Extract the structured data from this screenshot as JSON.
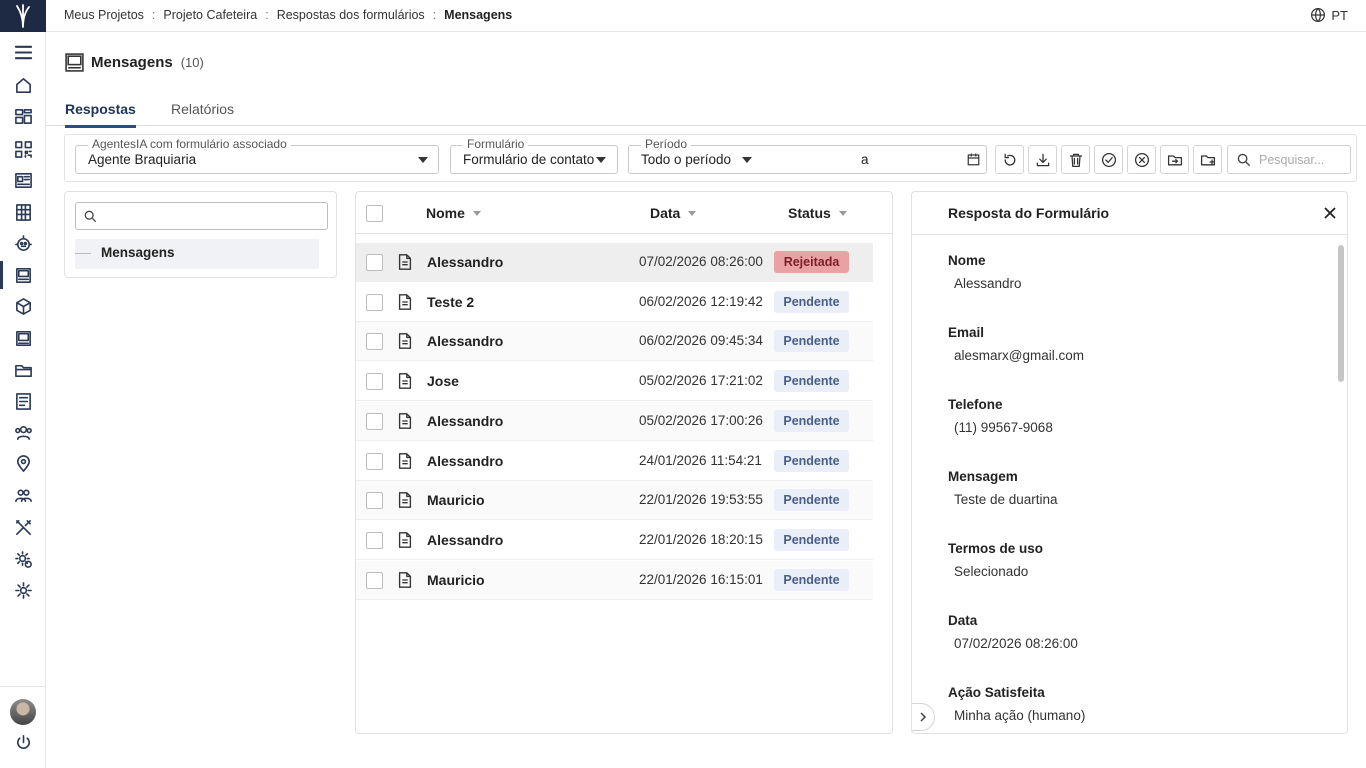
{
  "breadcrumb": {
    "items": [
      "Meus Projetos",
      "Projeto Cafeteira",
      "Respostas dos formulários"
    ],
    "separator": ":",
    "current": "Mensagens"
  },
  "language": {
    "label": "PT",
    "icon": "globe-icon"
  },
  "sidebar": {
    "items": [
      {
        "name": "menu",
        "icon": "menu-icon"
      },
      {
        "name": "home",
        "icon": "home-icon"
      },
      {
        "name": "dashboard",
        "icon": "dashboard-icon"
      },
      {
        "name": "qr-code",
        "icon": "qr-code-icon"
      },
      {
        "name": "content",
        "icon": "content-icon"
      },
      {
        "name": "grid",
        "icon": "grid-icon"
      },
      {
        "name": "agents",
        "icon": "robot-icon"
      },
      {
        "name": "forms",
        "icon": "forms-icon",
        "active": true
      },
      {
        "name": "packages",
        "icon": "cube-icon"
      },
      {
        "name": "screens",
        "icon": "monitor-icon"
      },
      {
        "name": "files",
        "icon": "folder-icon"
      },
      {
        "name": "reports",
        "icon": "report-icon"
      },
      {
        "name": "users",
        "icon": "users-icon"
      },
      {
        "name": "locations",
        "icon": "location-icon"
      },
      {
        "name": "teams",
        "icon": "team-icon"
      },
      {
        "name": "tools",
        "icon": "tools-icon"
      },
      {
        "name": "settings-admin",
        "icon": "settings-admin-icon"
      },
      {
        "name": "settings",
        "icon": "gear-icon"
      }
    ]
  },
  "page": {
    "title": "Mensagens",
    "count": "(10)"
  },
  "tabs": [
    {
      "label": "Respostas",
      "active": true
    },
    {
      "label": "Relatórios",
      "active": false
    }
  ],
  "filters": {
    "agent": {
      "legend": "AgentesIA com formulário associado",
      "value": "Agente Braquiaria"
    },
    "form": {
      "legend": "Formulário",
      "value": "Formulário de contato"
    },
    "period": {
      "legend": "Período",
      "value": "Todo o período",
      "separator": "a"
    },
    "search": {
      "placeholder": "Pesquisar..."
    }
  },
  "tree": {
    "search_placeholder": "",
    "items": [
      {
        "label": "Mensagens"
      }
    ]
  },
  "list": {
    "columns": {
      "name": "Nome",
      "date": "Data",
      "status": "Status"
    },
    "rows": [
      {
        "name": "Alessandro",
        "date": "07/02/2026 08:26:00",
        "status": "Rejeitada",
        "status_type": "rejected"
      },
      {
        "name": "Teste 2",
        "date": "06/02/2026 12:19:42",
        "status": "Pendente",
        "status_type": "pending"
      },
      {
        "name": "Alessandro",
        "date": "06/02/2026 09:45:34",
        "status": "Pendente",
        "status_type": "pending"
      },
      {
        "name": "Jose",
        "date": "05/02/2026 17:21:02",
        "status": "Pendente",
        "status_type": "pending"
      },
      {
        "name": "Alessandro",
        "date": "05/02/2026 17:00:26",
        "status": "Pendente",
        "status_type": "pending"
      },
      {
        "name": "Alessandro",
        "date": "24/01/2026 11:54:21",
        "status": "Pendente",
        "status_type": "pending"
      },
      {
        "name": "Mauricio",
        "date": "22/01/2026 19:53:55",
        "status": "Pendente",
        "status_type": "pending"
      },
      {
        "name": "Alessandro",
        "date": "22/01/2026 18:20:15",
        "status": "Pendente",
        "status_type": "pending"
      },
      {
        "name": "Mauricio",
        "date": "22/01/2026 16:15:01",
        "status": "Pendente",
        "status_type": "pending"
      }
    ]
  },
  "detail": {
    "title": "Resposta do Formulário",
    "fields": [
      {
        "label": "Nome",
        "value": "Alessandro"
      },
      {
        "label": "Email",
        "value": "alesmarx@gmail.com"
      },
      {
        "label": "Telefone",
        "value": "(11) 99567-9068"
      },
      {
        "label": "Mensagem",
        "value": "Teste de duartina"
      },
      {
        "label": "Termos de uso",
        "value": "Selecionado"
      },
      {
        "label": "Data",
        "value": "07/02/2026 08:26:00"
      },
      {
        "label": "Ação Satisfeita",
        "value": "Minha ação (humano)"
      }
    ]
  },
  "colors": {
    "brand_dark": "#1e2a44",
    "accent": "#2b4f7c",
    "badge_pending_bg": "#e9eef8",
    "badge_rejected_bg": "#e9a1a3"
  }
}
